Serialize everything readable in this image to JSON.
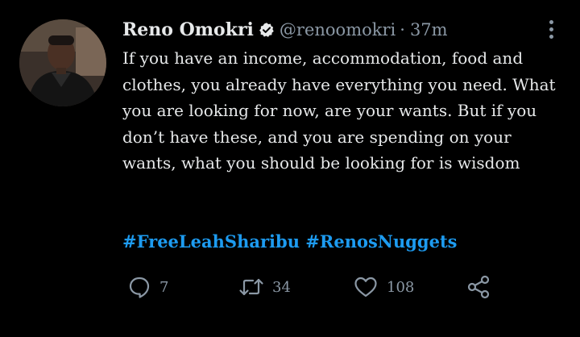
{
  "tweet": {
    "author": {
      "display_name": "Reno Omokri",
      "handle": "@renoomokri",
      "verified": true,
      "separator": "·",
      "time": "37m"
    },
    "text": "If you have an income, accommodation, food and clothes, you already have everything you need. What you are looking for now, are your wants. But if you don’t have these, and you are spending on your wants, what you should be looking for is wisdom",
    "hashtags": [
      "#FreeLeahSharibu",
      "#RenosNuggets"
    ],
    "actions": {
      "replies": "7",
      "retweets": "34",
      "likes": "108"
    }
  },
  "icons": {
    "verified": "verified-badge-icon",
    "more": "more-options-icon",
    "reply": "reply-icon",
    "retweet": "retweet-icon",
    "like": "heart-icon",
    "share": "share-icon"
  },
  "colors": {
    "background": "#000000",
    "text": "#e7e9ea",
    "muted": "#8b98a5",
    "link": "#1d9bf0"
  }
}
